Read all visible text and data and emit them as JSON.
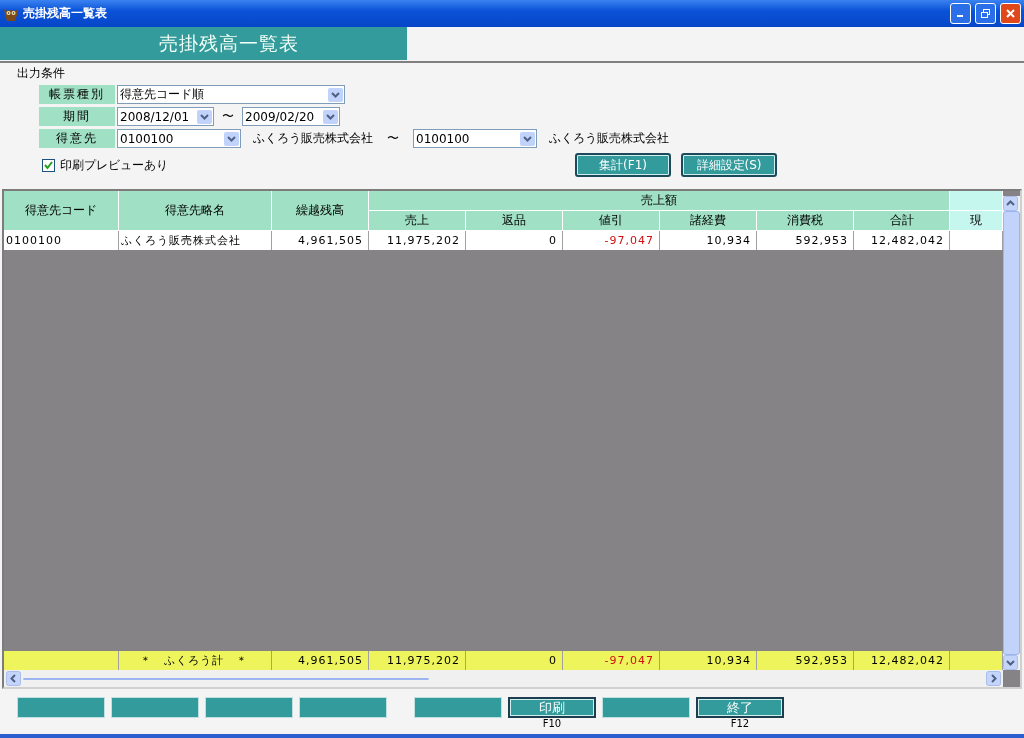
{
  "window": {
    "title": "売掛残高一覧表"
  },
  "banner": {
    "title": "売掛残高一覧表"
  },
  "conditions": {
    "heading": "出力条件",
    "rows": [
      {
        "kind": "single",
        "label": "帳票種別",
        "value": "得意先コード順"
      },
      {
        "kind": "range",
        "label": "期間",
        "from": "2008/12/01",
        "separator": "〜",
        "to": "2009/02/20"
      },
      {
        "kind": "named_range",
        "label": "得意先",
        "from": "0100100",
        "from_name": "ふくろう販売株式会社",
        "separator": "〜",
        "to": "0100100",
        "to_name": "ふくろう販売株式会社"
      }
    ],
    "preview": {
      "label": "印刷プレビューあり",
      "checked": true
    },
    "buttons": [
      "集計(F1)",
      "詳細設定(S)"
    ]
  },
  "table": {
    "group_header": "売上額",
    "columns": [
      {
        "kind": "single",
        "label": "得意先コード"
      },
      {
        "kind": "single",
        "label": "得意先略名"
      },
      {
        "kind": "single",
        "label": "繰越残高"
      },
      {
        "kind": "grouped",
        "label": "売上"
      },
      {
        "kind": "grouped",
        "label": "返品"
      },
      {
        "kind": "grouped",
        "label": "値引"
      },
      {
        "kind": "grouped",
        "label": "諸経費"
      },
      {
        "kind": "grouped",
        "label": "消費税"
      },
      {
        "kind": "grouped",
        "label": "合計"
      },
      {
        "kind": "cut",
        "label": "現"
      }
    ],
    "rows": [
      {
        "cells": [
          {
            "text": "0100100",
            "negative": false
          },
          {
            "text": "ふくろう販売株式会社",
            "negative": false
          },
          {
            "text": "4,961,505",
            "negative": false
          },
          {
            "text": "11,975,202",
            "negative": false
          },
          {
            "text": "0",
            "negative": false
          },
          {
            "text": "-97,047",
            "negative": true
          },
          {
            "text": "10,934",
            "negative": false
          },
          {
            "text": "592,953",
            "negative": false
          },
          {
            "text": "12,482,042",
            "negative": false
          }
        ]
      }
    ],
    "total_row": {
      "label": "＊　ふくろう計　＊",
      "cells": [
        {
          "text": "4,961,505",
          "negative": false
        },
        {
          "text": "11,975,202",
          "negative": false
        },
        {
          "text": "0",
          "negative": false
        },
        {
          "text": "-97,047",
          "negative": true
        },
        {
          "text": "10,934",
          "negative": false
        },
        {
          "text": "592,953",
          "negative": false
        },
        {
          "text": "12,482,042",
          "negative": false
        }
      ]
    }
  },
  "function_keys": [
    [
      {
        "kind": "blank"
      },
      {
        "kind": "blank"
      },
      {
        "kind": "blank"
      },
      {
        "kind": "blank"
      }
    ],
    [
      {
        "kind": "blank"
      },
      {
        "kind": "labeled",
        "label": "印刷",
        "key": "F10"
      },
      {
        "kind": "blank"
      },
      {
        "kind": "labeled",
        "label": "終了",
        "key": "F12"
      }
    ]
  ]
}
